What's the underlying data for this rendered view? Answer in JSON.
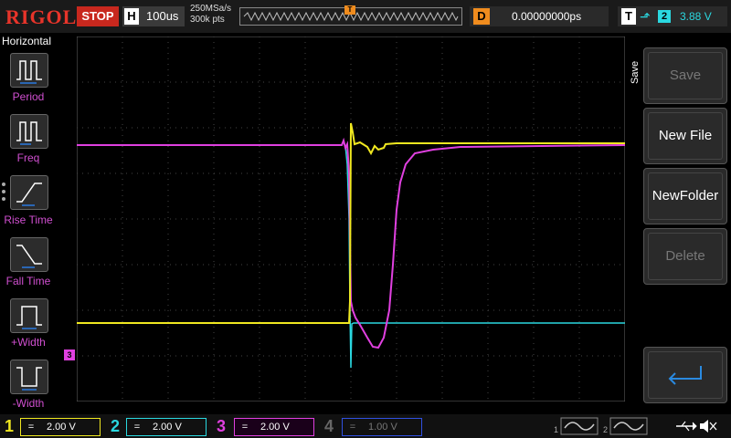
{
  "brand": "RIGOL",
  "run_state": "STOP",
  "timebase": {
    "label": "H",
    "value": "100us"
  },
  "acquisition": {
    "sample_rate": "250MSa/s",
    "memory_depth": "300k pts"
  },
  "trigger_pos_marker": "T",
  "delay": {
    "label": "D",
    "value": "0.00000000ps"
  },
  "trigger": {
    "label": "T",
    "edge_icon": "rising-edge-icon",
    "source": "2",
    "level": "3.88 V"
  },
  "left_menu": {
    "title": "Horizontal",
    "items": [
      {
        "label": "Period",
        "icon": "period-icon"
      },
      {
        "label": "Freq",
        "icon": "frequency-icon"
      },
      {
        "label": "Rise Time",
        "icon": "rise-time-icon"
      },
      {
        "label": "Fall Time",
        "icon": "fall-time-icon"
      },
      {
        "label": "+Width",
        "icon": "positive-width-icon"
      },
      {
        "label": "-Width",
        "icon": "negative-width-icon"
      }
    ]
  },
  "right_menu": {
    "title": "Save",
    "items": [
      {
        "label": "Save",
        "enabled": false
      },
      {
        "label": "New File",
        "enabled": true
      },
      {
        "label": "NewFolder",
        "enabled": true
      },
      {
        "label": "Delete",
        "enabled": false
      }
    ],
    "enter_icon": "enter-icon"
  },
  "channels": [
    {
      "num": "1",
      "coupling": "=",
      "scale": "2.00 V",
      "color": "#f0e820",
      "active": true
    },
    {
      "num": "2",
      "coupling": "=",
      "scale": "2.00 V",
      "color": "#2ad8e0",
      "active": true
    },
    {
      "num": "3",
      "coupling": "=",
      "scale": "2.00 V",
      "color": "#e040e0",
      "active": true
    },
    {
      "num": "4",
      "coupling": "=",
      "scale": "1.00 V",
      "color": "#3050e0",
      "active": false
    }
  ],
  "markers": {
    "trigger_level": "T",
    "ch3_ref": "3"
  },
  "bottom_right": {
    "gen1": "1",
    "gen2": "2",
    "usb_icon": "usb-icon",
    "sound_icon": "speaker-muted-icon"
  },
  "colors": {
    "ch1": "#f0e820",
    "ch2": "#2ad8e0",
    "ch3": "#e040e0",
    "ch4": "#3050e0",
    "trigger": "#f08c1e",
    "brand": "#e8342a"
  }
}
